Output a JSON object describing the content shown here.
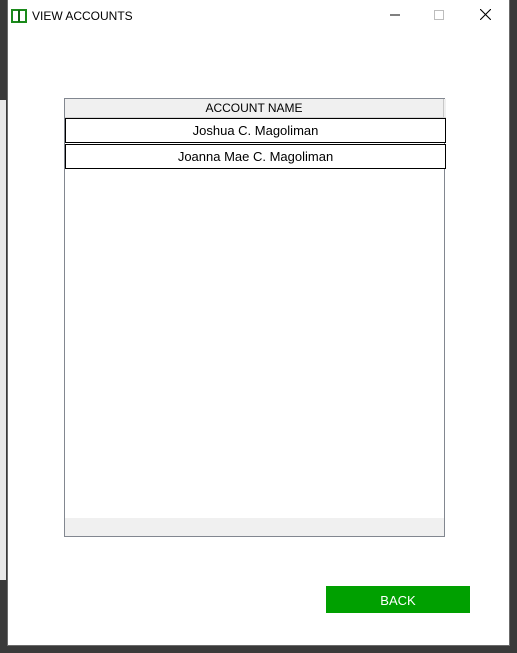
{
  "window": {
    "title": "VIEW ACCOUNTS",
    "icon": "book-icon",
    "controls": {
      "minimize_icon": "minimize-icon",
      "maximize_icon": "maximize-icon",
      "close_icon": "close-icon"
    }
  },
  "table": {
    "columns": [
      "ACCOUNT NAME"
    ],
    "rows": [
      [
        "Joshua C. Magoliman"
      ],
      [
        "Joanna Mae C. Magoliman"
      ]
    ]
  },
  "actions": {
    "back_label": "BACK"
  },
  "colors": {
    "accent_button": "#00a000",
    "icon_green": "#1b8a1b"
  }
}
